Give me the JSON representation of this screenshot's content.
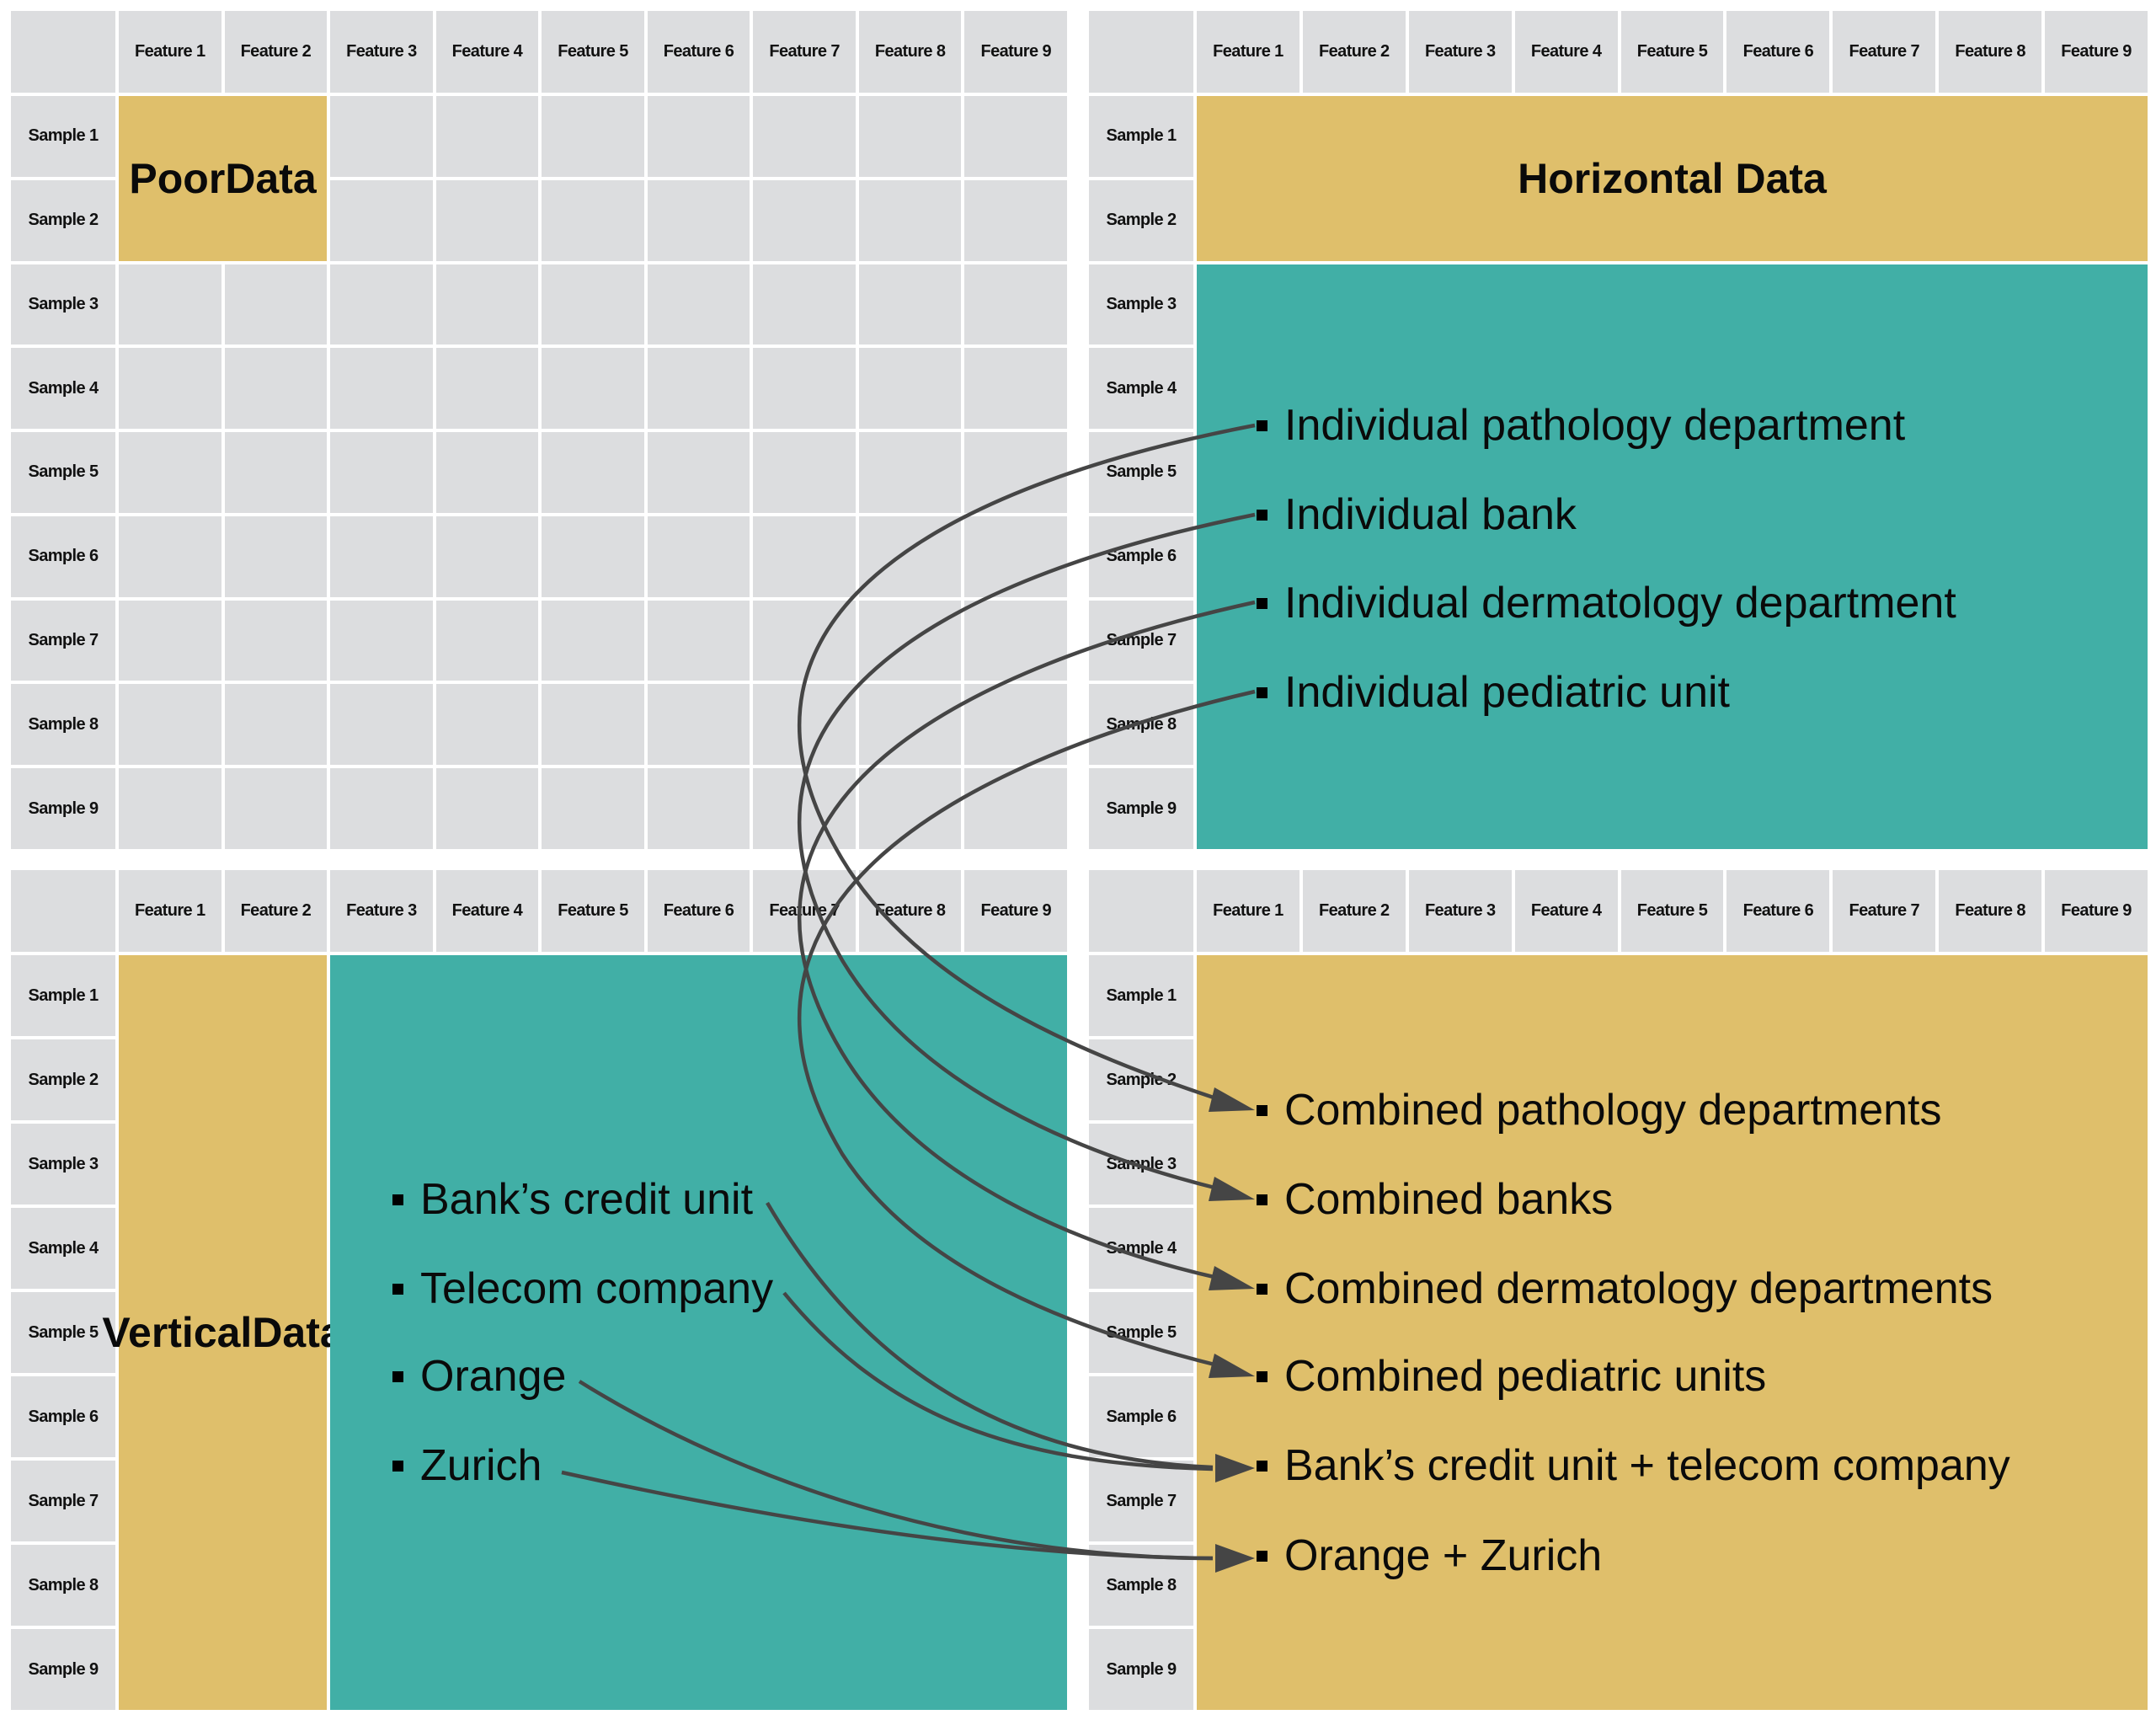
{
  "colors": {
    "gold": "#dfbf6b",
    "teal": "#41afa6",
    "cell_gray": "#dcdddf",
    "arrow": "#454545",
    "text": "#0a0a0a"
  },
  "features": [
    "Feature 1",
    "Feature 2",
    "Feature 3",
    "Feature 4",
    "Feature 5",
    "Feature 6",
    "Feature 7",
    "Feature 8",
    "Feature 9"
  ],
  "samples": [
    "Sample 1",
    "Sample 2",
    "Sample 3",
    "Sample 4",
    "Sample 5",
    "Sample 6",
    "Sample 7",
    "Sample 8",
    "Sample 9"
  ],
  "panels": {
    "poor": {
      "label_line1": "Poor",
      "label_line2": "Data"
    },
    "horizontal": {
      "label": "Horizontal Data",
      "items": [
        "Individual pathology department",
        "Individual bank",
        "Individual dermatology department",
        "Individual pediatric unit"
      ]
    },
    "vertical": {
      "label_line1": "Vertical",
      "label_line2": "Data",
      "items": [
        "Bank’s credit unit",
        "Telecom company",
        "Orange",
        "Zurich"
      ]
    },
    "combined": {
      "items": [
        "Combined pathology departments",
        "Combined banks",
        "Combined dermatology departments",
        "Combined pediatric units",
        "Bank’s credit unit + telecom company",
        "Orange + Zurich"
      ]
    }
  },
  "links": [
    {
      "from": "Individual pathology department",
      "to": "Combined pathology departments"
    },
    {
      "from": "Individual bank",
      "to": "Combined banks"
    },
    {
      "from": "Individual dermatology department",
      "to": "Combined dermatology departments"
    },
    {
      "from": "Individual pediatric unit",
      "to": "Combined pediatric units"
    },
    {
      "from": "Bank’s credit unit",
      "to": "Bank’s credit unit + telecom company"
    },
    {
      "from": "Telecom company",
      "to": "Bank’s credit unit + telecom company"
    },
    {
      "from": "Orange",
      "to": "Orange + Zurich"
    },
    {
      "from": "Zurich",
      "to": "Orange + Zurich"
    }
  ]
}
